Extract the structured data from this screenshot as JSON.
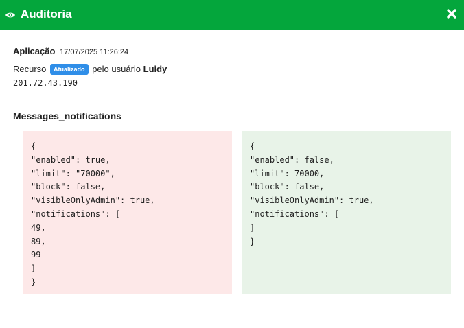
{
  "header": {
    "title": "Auditoria",
    "icon": "eye-icon",
    "close_icon": "close-icon",
    "background": "#04a63c"
  },
  "meta": {
    "application_label": "Aplicação",
    "timestamp": "17/07/2025 11:26:24",
    "resource_label": "Recurso",
    "status_badge": "Atualizado",
    "badge_color": "#2f8ee8",
    "by_user_text": "pelo usuário",
    "user": "Luidy",
    "ip": "201.72.43.190"
  },
  "section": {
    "title": "Messages_notifications"
  },
  "diff": {
    "old_color": "#fde8e8",
    "new_color": "#e8f3e8",
    "old_lines": [
      "{",
      "\"enabled\": true,",
      "\"limit\": \"70000\",",
      "\"block\": false,",
      "\"visibleOnlyAdmin\": true,",
      "\"notifications\": [",
      "49,",
      "89,",
      "99",
      "]",
      "}"
    ],
    "new_lines": [
      "{",
      "\"enabled\": false,",
      "\"limit\": 70000,",
      "\"block\": false,",
      "\"visibleOnlyAdmin\": true,",
      "\"notifications\": [",
      "]",
      "}"
    ]
  }
}
